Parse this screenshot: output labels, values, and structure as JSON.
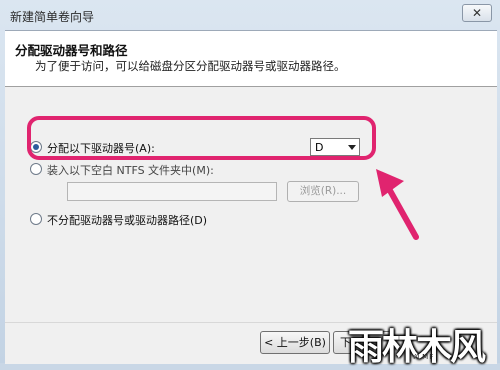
{
  "window": {
    "title": "新建简单卷向导",
    "close_label": "✕"
  },
  "header": {
    "title": "分配驱动器号和路径",
    "subtitle": "为了便于访问，可以给磁盘分区分配驱动器号或驱动器路径。"
  },
  "options": {
    "assign_letter": {
      "label": "分配以下驱动器号(A):",
      "selected": true,
      "drive_letter": "D"
    },
    "mount_folder": {
      "label": "装入以下空白 NTFS 文件夹中(M):",
      "path_value": "",
      "browse_label": "浏览(R)..."
    },
    "no_assign": {
      "label": "不分配驱动器号或驱动器路径(D)"
    }
  },
  "footer": {
    "back_label": "< 上一步(B)",
    "next_label": "下一"
  },
  "annotation": {
    "color": "#e0246f"
  },
  "watermark": {
    "text": "雨林木风",
    "sub": "YLMF"
  }
}
